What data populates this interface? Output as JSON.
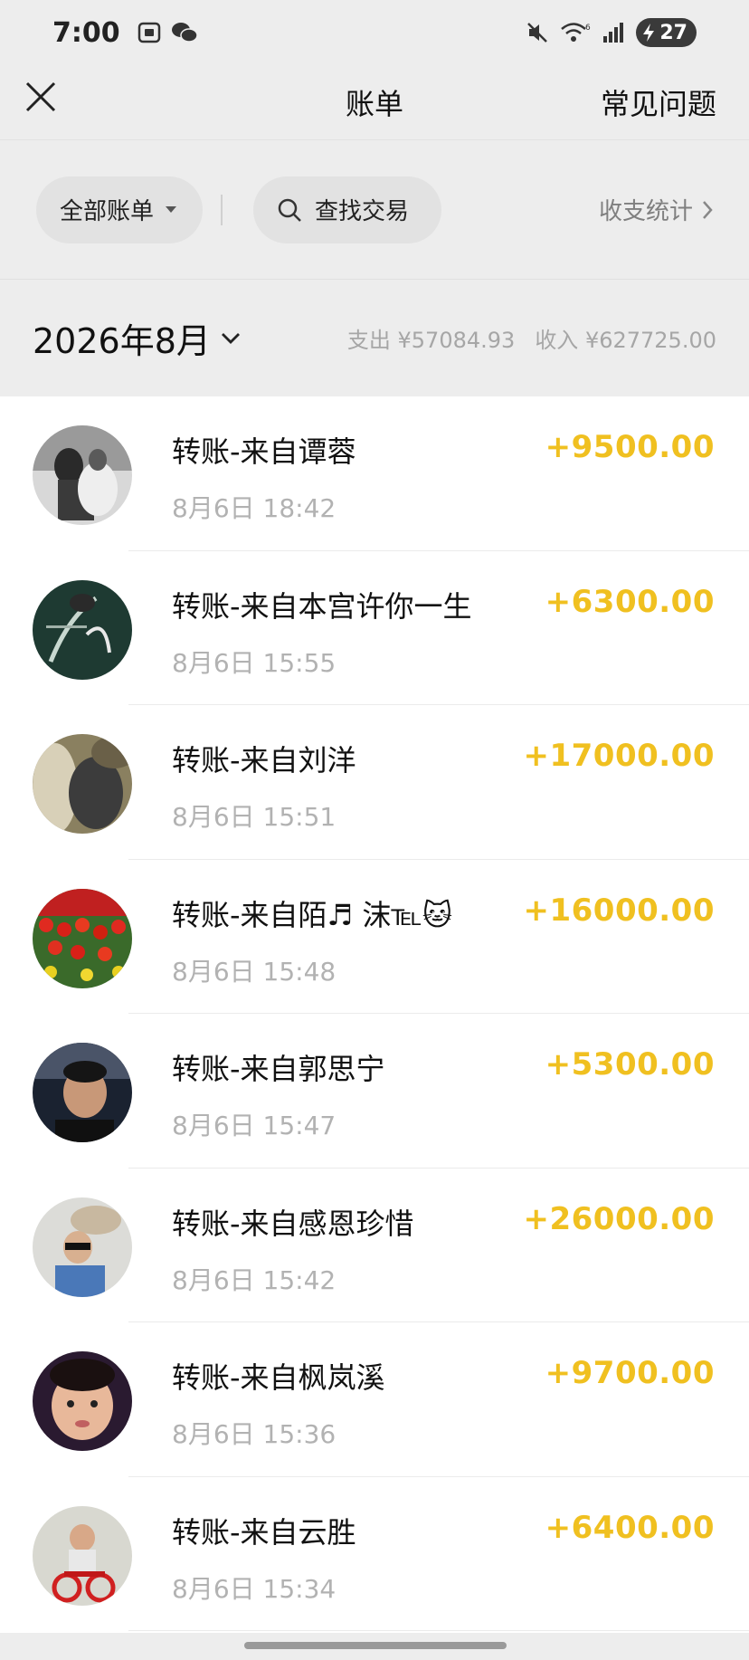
{
  "status": {
    "time": "7:00",
    "battery": "27",
    "wifi_badge": "6"
  },
  "nav": {
    "title": "账单",
    "faq_label": "常见问题"
  },
  "filters": {
    "all_bills_label": "全部账单",
    "search_label": "查找交易",
    "stats_label": "收支统计"
  },
  "month": {
    "label": "2026年8月",
    "expense": "支出 ¥57084.93",
    "income": "收入 ¥627725.00"
  },
  "transactions": [
    {
      "title": "转账-来自谭蓉",
      "time": "8月6日 18:42",
      "amount": "+9500.00"
    },
    {
      "title": "转账-来自本宫许你一生",
      "time": "8月6日 15:55",
      "amount": "+6300.00"
    },
    {
      "title": "转账-来自刘洋",
      "time": "8月6日 15:51",
      "amount": "+17000.00"
    },
    {
      "title": "转账-来自陌♬ 沫℡🐱",
      "time": "8月6日 15:48",
      "amount": "+16000.00"
    },
    {
      "title": "转账-来自郭思宁",
      "time": "8月6日 15:47",
      "amount": "+5300.00"
    },
    {
      "title": "转账-来自感恩珍惜",
      "time": "8月6日 15:42",
      "amount": "+26000.00"
    },
    {
      "title": "转账-来自枫岚溪",
      "time": "8月6日 15:36",
      "amount": "+9700.00"
    },
    {
      "title": "转账-来自云胜",
      "time": "8月6日 15:34",
      "amount": "+6400.00"
    }
  ],
  "colors": {
    "amount": "#f0c020",
    "background": "#ededed",
    "list_background": "#ffffff"
  }
}
